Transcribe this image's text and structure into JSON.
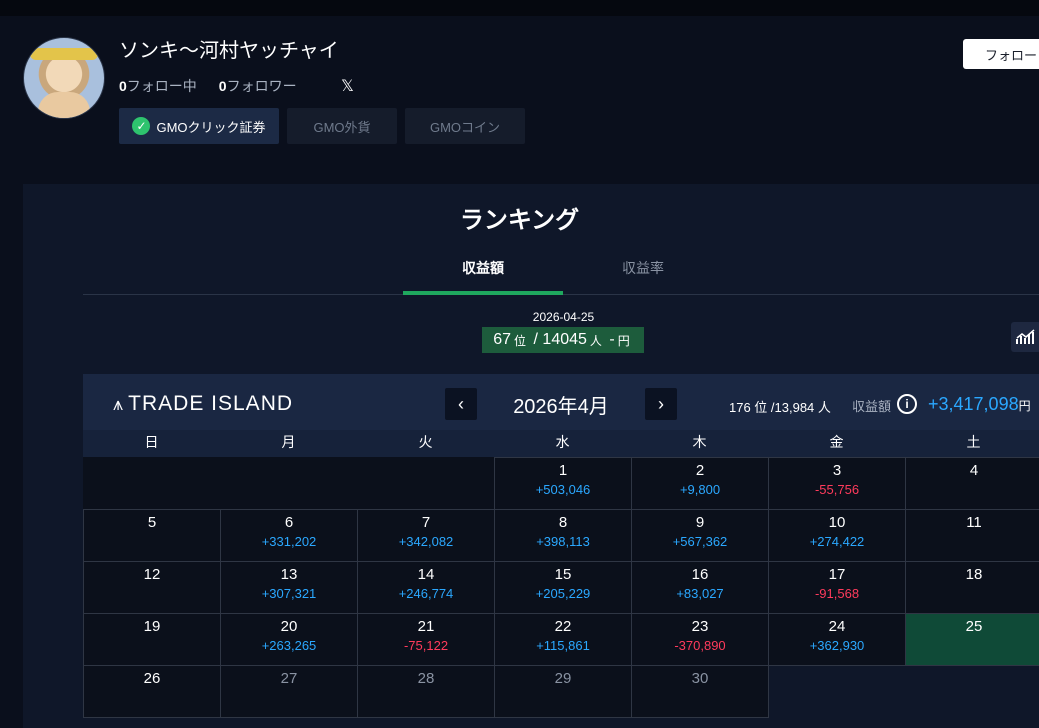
{
  "profile": {
    "name": "ソンキ〜河村ヤッチャイ",
    "following_count": "0",
    "following_label": "フォロー中",
    "followers_count": "0",
    "followers_label": "フォロワー",
    "follow_button": "フォロー",
    "social_icon": "x-icon",
    "brokers": [
      {
        "label": "GMOクリック証券",
        "active": true
      },
      {
        "label": "GMO外貨",
        "active": false
      },
      {
        "label": "GMOコイン",
        "active": false
      }
    ]
  },
  "ranking": {
    "title": "ランキング",
    "tabs": [
      "収益額",
      "収益率"
    ],
    "active_tab": "収益額",
    "date": "2026-04-25",
    "rank": "67",
    "rank_unit": "位",
    "separator": "/",
    "total": "14045",
    "total_unit": "人",
    "amount": "-",
    "amount_unit": "円"
  },
  "calendar": {
    "logo": "TRADE ISLAND",
    "prev": "‹",
    "next": "›",
    "month": "2026年4月",
    "monthly_rank": "176 位 /13,984 人",
    "income_label": "収益額",
    "income_value": "+3,417,098",
    "income_unit": "円",
    "weekdays": [
      "日",
      "月",
      "火",
      "水",
      "木",
      "金",
      "土"
    ],
    "today": "25",
    "cells": [
      {
        "day": "",
        "value": ""
      },
      {
        "day": "",
        "value": ""
      },
      {
        "day": "",
        "value": ""
      },
      {
        "day": "1",
        "value": "+503,046"
      },
      {
        "day": "2",
        "value": "+9,800"
      },
      {
        "day": "3",
        "value": "-55,756"
      },
      {
        "day": "4",
        "value": ""
      },
      {
        "day": "5",
        "value": ""
      },
      {
        "day": "6",
        "value": "+331,202"
      },
      {
        "day": "7",
        "value": "+342,082"
      },
      {
        "day": "8",
        "value": "+398,113"
      },
      {
        "day": "9",
        "value": "+567,362"
      },
      {
        "day": "10",
        "value": "+274,422"
      },
      {
        "day": "11",
        "value": ""
      },
      {
        "day": "12",
        "value": ""
      },
      {
        "day": "13",
        "value": "+307,321"
      },
      {
        "day": "14",
        "value": "+246,774"
      },
      {
        "day": "15",
        "value": "+205,229"
      },
      {
        "day": "16",
        "value": "+83,027"
      },
      {
        "day": "17",
        "value": "-91,568"
      },
      {
        "day": "18",
        "value": ""
      },
      {
        "day": "19",
        "value": ""
      },
      {
        "day": "20",
        "value": "+263,265"
      },
      {
        "day": "21",
        "value": "-75,122"
      },
      {
        "day": "22",
        "value": "+115,861"
      },
      {
        "day": "23",
        "value": "-370,890"
      },
      {
        "day": "24",
        "value": "+362,930"
      },
      {
        "day": "25",
        "value": ""
      },
      {
        "day": "26",
        "value": ""
      },
      {
        "day": "27",
        "value": ""
      },
      {
        "day": "28",
        "value": ""
      },
      {
        "day": "29",
        "value": ""
      },
      {
        "day": "30",
        "value": ""
      }
    ]
  },
  "colors": {
    "positive": "#2ba8ff",
    "negative": "#ff3b5c",
    "accent": "#1fa85e",
    "today_bg": "#0f4a37"
  }
}
